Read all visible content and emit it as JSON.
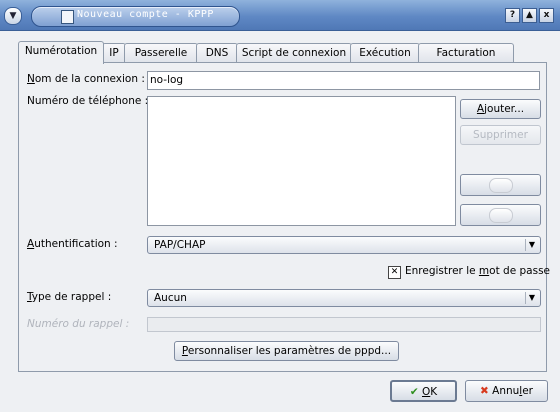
{
  "window": {
    "title": "Nouveau compte - KPPP",
    "help_button": "?",
    "maximize_button": "▲",
    "close_button": "x"
  },
  "tabs": [
    "Numérotation",
    "IP",
    "Passerelle",
    "DNS",
    "Script de connexion",
    "Exécution",
    "Facturation"
  ],
  "form": {
    "connection_name_label_a": "N",
    "connection_name_label_b": "om de la connexion :",
    "connection_name_value": "no-log",
    "phone_label": "Numéro de téléphone :",
    "add_button_a": "A",
    "add_button_b": "jouter...",
    "delete_button": "Supprimer",
    "auth_label_a": "A",
    "auth_label_b": "uthentification :",
    "auth_value": "PAP/CHAP",
    "save_password_label_a": "Enregistrer le ",
    "save_password_label_b": "m",
    "save_password_label_c": "ot de passe",
    "save_password_checked": true,
    "callback_label_a": "T",
    "callback_label_b": "ype de rappel :",
    "callback_value": "Aucun",
    "callback_number_label": "Numéro du rappel :",
    "pppd_button_a": "P",
    "pppd_button_b": "ersonnaliser les paramètres de pppd..."
  },
  "footer": {
    "ok_a": "O",
    "ok_b": "K",
    "cancel_a": "Annu",
    "cancel_b": "l",
    "cancel_c": "er"
  },
  "colors": {
    "titlebar": "#5f88c4",
    "ok_check": "#2f8f1f",
    "cancel_x": "#d83a1e"
  }
}
